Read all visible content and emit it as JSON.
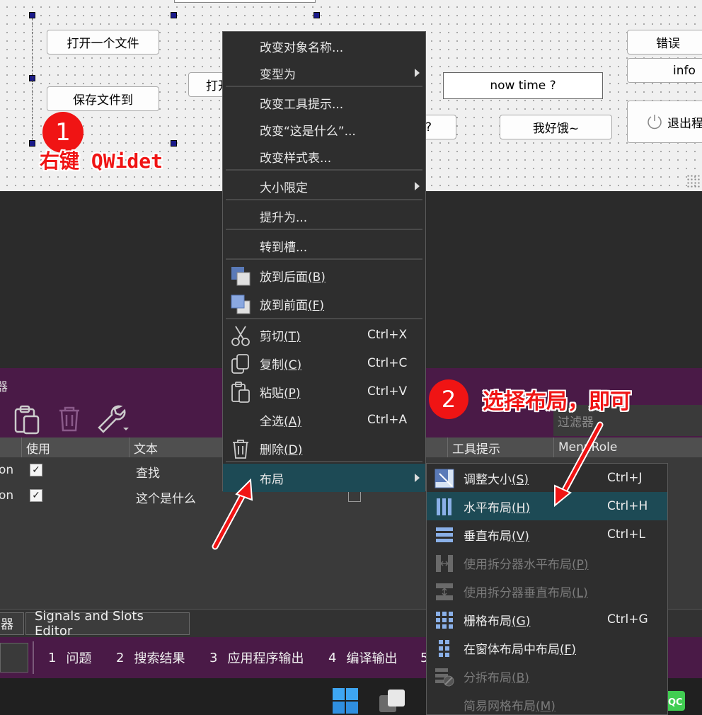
{
  "form": {
    "buttons": {
      "open_file": "打开一个文件",
      "save_file": "保存文件到",
      "open_partial": "打开",
      "unknown_partial": "?",
      "hungry": "我好饿~",
      "error": "错误",
      "info": "info",
      "exit": "退出程"
    },
    "now_time": "now time ?"
  },
  "annotations": {
    "step1_num": "1",
    "step1_text": "右键 QWidet",
    "step2_num": "2",
    "step2_text": "选择布局，即可"
  },
  "action_editor": {
    "title_partial": "器",
    "filter_placeholder": "过滤器",
    "columns": [
      "使用",
      "文本",
      "工具提示",
      "MenuRole"
    ],
    "rows": [
      {
        "name_partial": "on",
        "used": "✓",
        "text": "查找"
      },
      {
        "name_partial": "on",
        "used": "✓",
        "text": "这个是什么"
      }
    ]
  },
  "bottom_tabs": {
    "tab_partial": "器",
    "signals_slots": "Signals and Slots Editor"
  },
  "output_panes": [
    {
      "num": "1",
      "label": "问题"
    },
    {
      "num": "2",
      "label": "搜索结果"
    },
    {
      "num": "3",
      "label": "应用程序输出"
    },
    {
      "num": "4",
      "label": "编译输出"
    },
    {
      "num": "5",
      "label": ""
    }
  ],
  "context_menu": {
    "items": [
      {
        "label": "改变对象名称..."
      },
      {
        "label": "变型为"
      },
      {
        "label": "改变工具提示..."
      },
      {
        "label": "改变“这是什么”..."
      },
      {
        "label": "改变样式表..."
      },
      {
        "label": "大小限定"
      },
      {
        "label": "提升为..."
      },
      {
        "label": "转到槽..."
      },
      {
        "label": "放到后面",
        "mnemonic": "(B)"
      },
      {
        "label": "放到前面",
        "mnemonic": "(F)"
      },
      {
        "label": "剪切",
        "mnemonic": "(T)",
        "shortcut": "Ctrl+X"
      },
      {
        "label": "复制",
        "mnemonic": "(C)",
        "shortcut": "Ctrl+C"
      },
      {
        "label": "粘贴",
        "mnemonic": "(P)",
        "shortcut": "Ctrl+V"
      },
      {
        "label": "全选",
        "mnemonic": "(A)",
        "shortcut": "Ctrl+A"
      },
      {
        "label": "删除",
        "mnemonic": "(D)"
      },
      {
        "label": "布局"
      }
    ]
  },
  "layout_submenu": {
    "items": [
      {
        "label": "调整大小",
        "mnemonic": "(S)",
        "shortcut": "Ctrl+J"
      },
      {
        "label": "水平布局",
        "mnemonic": "(H)",
        "shortcut": "Ctrl+H"
      },
      {
        "label": "垂直布局",
        "mnemonic": "(V)",
        "shortcut": "Ctrl+L"
      },
      {
        "label": "使用拆分器水平布局",
        "mnemonic": "(P)"
      },
      {
        "label": "使用拆分器垂直布局",
        "mnemonic": "(L)"
      },
      {
        "label": "栅格布局",
        "mnemonic": "(G)",
        "shortcut": "Ctrl+G"
      },
      {
        "label": "在窗体布局中布局",
        "mnemonic": "(F)"
      },
      {
        "label": "分拆布局",
        "mnemonic": "(B)"
      },
      {
        "label": "简易网格布局",
        "mnemonic": "(M)"
      }
    ]
  },
  "colors": {
    "accent_purple": "#4a1a47",
    "menu_highlight": "#1d4a55",
    "annotation_red": "#f01414"
  }
}
